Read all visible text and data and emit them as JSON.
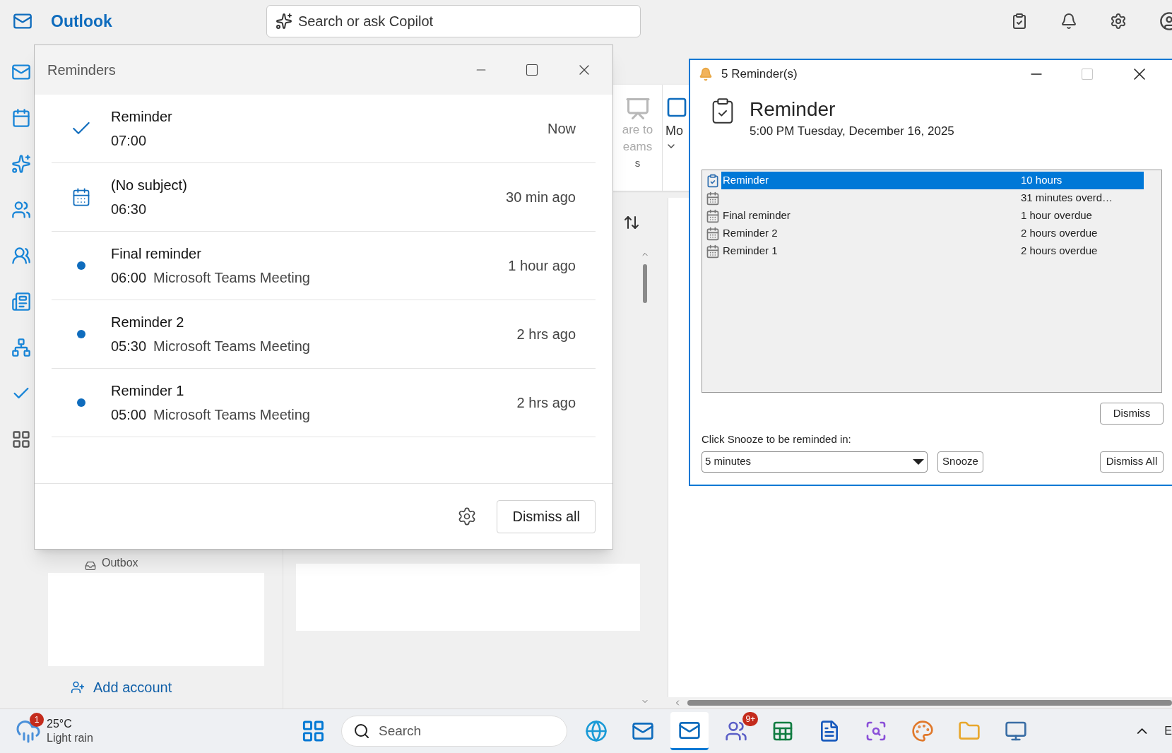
{
  "app": {
    "name": "Outlook",
    "search_placeholder": "Search or ask Copilot"
  },
  "ribbon": {
    "share_lines": [
      "are to",
      "eams"
    ],
    "group_label": "s",
    "more_label": "Mo"
  },
  "folders": {
    "outbox": "Outbox",
    "add_account": "Add account"
  },
  "reminders_window": {
    "title": "Reminders",
    "dismiss_all": "Dismiss all",
    "items": [
      {
        "kind": "task",
        "title": "Reminder",
        "time": "07:00",
        "when": "Now"
      },
      {
        "kind": "calendar",
        "title": "(No subject)",
        "time": "06:30",
        "when": "30 min ago"
      },
      {
        "kind": "dot",
        "title": "Final reminder",
        "time": "06:00",
        "location": "Microsoft Teams Meeting",
        "when": "1 hour ago"
      },
      {
        "kind": "dot",
        "title": "Reminder 2",
        "time": "05:30",
        "location": "Microsoft Teams Meeting",
        "when": "2 hrs ago"
      },
      {
        "kind": "dot",
        "title": "Reminder 1",
        "time": "05:00",
        "location": "Microsoft Teams Meeting",
        "when": "2 hrs ago"
      }
    ]
  },
  "classic_dialog": {
    "title": "5 Reminder(s)",
    "subject": "Reminder",
    "date": "5:00 PM Tuesday, December 16, 2025",
    "rows": [
      {
        "kind": "task",
        "subject": "Reminder",
        "due": "10 hours",
        "selected": true
      },
      {
        "kind": "appointment",
        "due": "31 minutes overd…",
        "selected": false
      },
      {
        "kind": "appointment",
        "subject": "Final reminder",
        "due": "1 hour overdue",
        "selected": false
      },
      {
        "kind": "appointment",
        "subject": "Reminder 2",
        "due": "2 hours overdue",
        "selected": false
      },
      {
        "kind": "appointment",
        "subject": "Reminder 1",
        "due": "2 hours overdue",
        "selected": false
      }
    ],
    "dismiss": "Dismiss",
    "snooze_label": "Click Snooze to be reminded in:",
    "snooze_value": "5 minutes",
    "snooze": "Snooze",
    "dismiss_all": "Dismiss All"
  },
  "taskbar": {
    "weather": {
      "badge": "1",
      "temp": "25°C",
      "condition": "Light rain"
    },
    "search_placeholder": "Search",
    "apps": [
      {
        "kind": "browser",
        "selected": false
      },
      {
        "kind": "mail",
        "selected": false
      },
      {
        "kind": "mail",
        "selected": true
      },
      {
        "kind": "people",
        "selected": false,
        "badge": "9+"
      },
      {
        "kind": "sheet",
        "selected": false
      },
      {
        "kind": "doc",
        "selected": false
      },
      {
        "kind": "scan",
        "selected": false
      },
      {
        "kind": "palette",
        "selected": false
      },
      {
        "kind": "folder",
        "selected": false
      },
      {
        "kind": "monitor",
        "selected": false
      }
    ],
    "language": "E"
  }
}
